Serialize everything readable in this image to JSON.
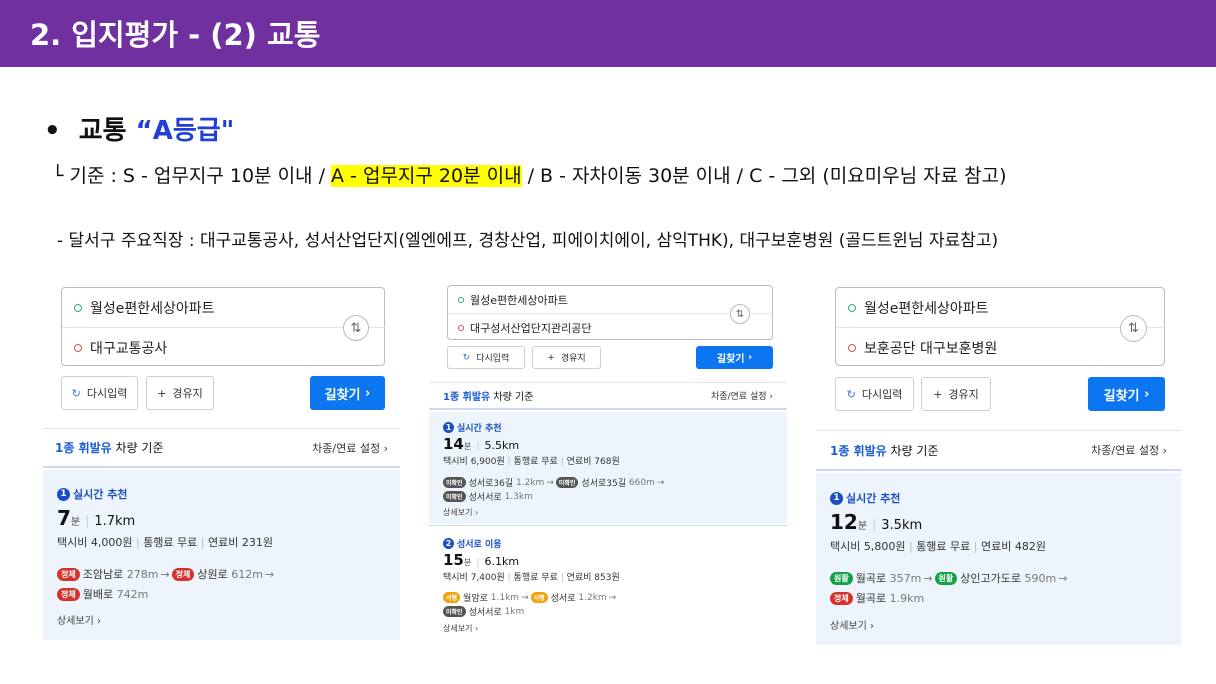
{
  "slide": {
    "title": "2. 입지평가 - (2) 교통",
    "bullet": {
      "mark": "•",
      "prefix": "교통 ",
      "highlight": "“A등급\""
    },
    "criteria": {
      "before": "└ 기준 : S - 업무지구 10분 이내 / ",
      "highlight": "A - 업무지구 20분 이내",
      "after": " / B - 자차이동 30분 이내  / C - 그외 (미요미우님 자료 참고)"
    },
    "subnote": "- 달서구 주요직장 : 대구교통공사, 성서산업단지(엘엔에프,  경창산업,  피에이치에이,  삼익THK), 대구보훈병원 (골드트윈님 자료참고)"
  },
  "colors": {
    "title_bar": "#7030a0",
    "accent_blue": "#1f3fd6",
    "highlight": "#ffff00",
    "route_blue": "#0b76ef"
  },
  "panels": [
    {
      "origin": "월성e편한세상아파트",
      "destination": "대구교통공사",
      "swap_icon": "⇅",
      "reset_label": "다시입력",
      "waypoint_label": "경유지",
      "search_label": "길찾기",
      "header_label": "1종 휘발유",
      "header_suffix": " 차량 기준",
      "settings_label": "차종/연료 설정",
      "results": [
        {
          "rank": "1",
          "label": "실시간 추천",
          "minutes": "7",
          "minutes_unit": "분",
          "distance": "1.7km",
          "taxi": "택시비 4,000원",
          "toll": "통행료 무료",
          "fuel": "연료비 231원",
          "roads": [
            [
              {
                "tag": "정체",
                "color": "red",
                "name": "조암남로",
                "dist": "278m"
              },
              {
                "tag": "정체",
                "color": "red",
                "name": "상원로",
                "dist": "612m"
              }
            ],
            [
              {
                "tag": "정체",
                "color": "red",
                "name": "월배로",
                "dist": "742m"
              }
            ]
          ],
          "more": "상세보기"
        }
      ]
    },
    {
      "origin": "월성e편한세상아파트",
      "destination": "대구성서산업단지관리공단",
      "swap_icon": "⇅",
      "reset_label": "다시입력",
      "waypoint_label": "경유지",
      "search_label": "길찾기",
      "header_label": "1종 휘발유",
      "header_suffix": " 차량 기준",
      "settings_label": "차종/연료 설정",
      "results": [
        {
          "rank": "1",
          "label": "실시간 추천",
          "minutes": "14",
          "minutes_unit": "분",
          "distance": "5.5km",
          "taxi": "택시비 6,900원",
          "toll": "통행료 무료",
          "fuel": "연료비 768원",
          "roads": [
            [
              {
                "tag": "미확인",
                "color": "gry",
                "name": "성서로36길",
                "dist": "1.2km"
              },
              {
                "tag": "미확인",
                "color": "gry",
                "name": "성서로35길",
                "dist": "660m"
              }
            ],
            [
              {
                "tag": "미확인",
                "color": "gry",
                "name": "성서서로",
                "dist": "1.3km"
              }
            ]
          ],
          "more": "상세보기"
        },
        {
          "rank": "2",
          "label": "성서로 이용",
          "minutes": "15",
          "minutes_unit": "분",
          "distance": "6.1km",
          "taxi": "택시비 7,400원",
          "toll": "통행료 무료",
          "fuel": "연료비 853원",
          "roads": [
            [
              {
                "tag": "서행",
                "color": "ylw",
                "name": "월암로",
                "dist": "1.1km"
              },
              {
                "tag": "서행",
                "color": "ylw",
                "name": "성서로",
                "dist": "1.2km"
              }
            ],
            [
              {
                "tag": "미확인",
                "color": "gry",
                "name": "성서서로",
                "dist": "1km"
              }
            ]
          ],
          "more": "상세보기"
        }
      ]
    },
    {
      "origin": "월성e편한세상아파트",
      "destination": "보훈공단 대구보훈병원",
      "swap_icon": "⇅",
      "reset_label": "다시입력",
      "waypoint_label": "경유지",
      "search_label": "길찾기",
      "header_label": "1종 휘발유",
      "header_suffix": " 차량 기준",
      "settings_label": "차종/연료 설정",
      "results": [
        {
          "rank": "1",
          "label": "실시간 추천",
          "minutes": "12",
          "minutes_unit": "분",
          "distance": "3.5km",
          "taxi": "택시비 5,800원",
          "toll": "통행료 무료",
          "fuel": "연료비 482원",
          "roads": [
            [
              {
                "tag": "원활",
                "color": "grn",
                "name": "월곡로",
                "dist": "357m"
              },
              {
                "tag": "원활",
                "color": "grn",
                "name": "상인고가도로",
                "dist": "590m"
              }
            ],
            [
              {
                "tag": "정체",
                "color": "red",
                "name": "월곡로",
                "dist": "1.9km"
              }
            ]
          ],
          "more": "상세보기"
        }
      ]
    }
  ]
}
